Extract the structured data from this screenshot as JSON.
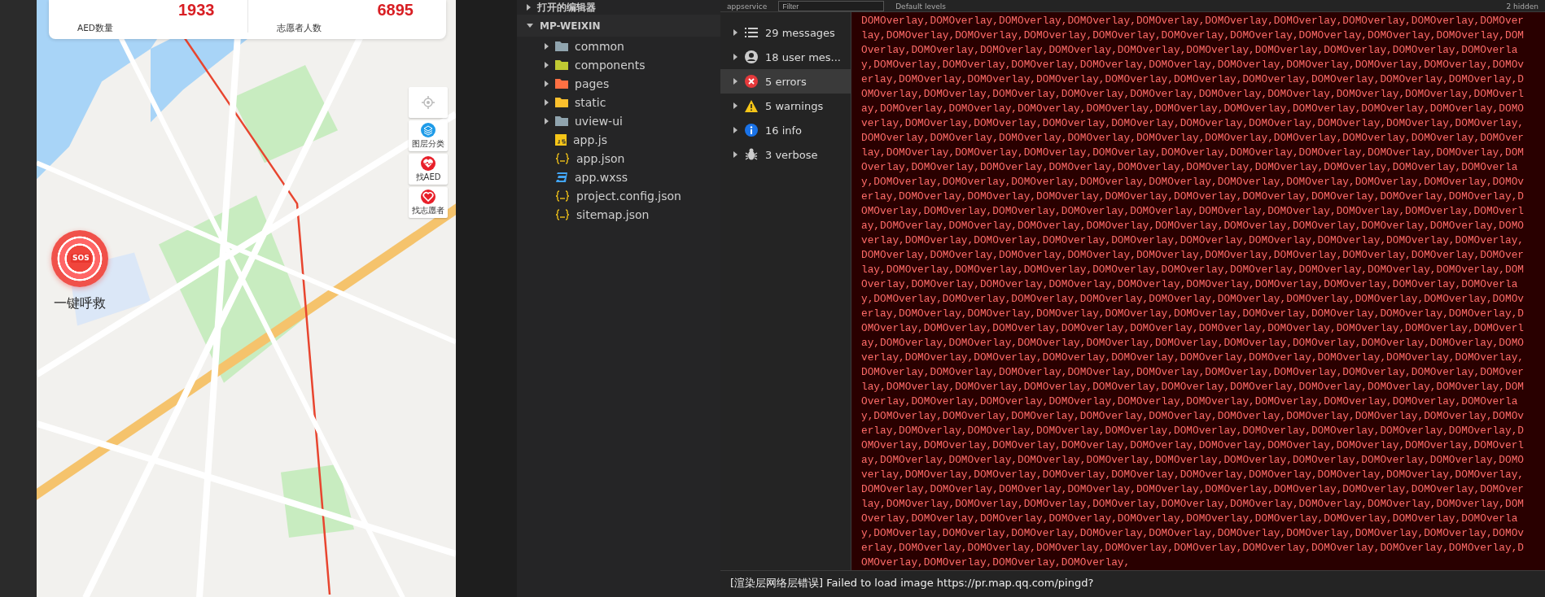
{
  "phone": {
    "stats": [
      {
        "value": "1933",
        "label": "AED数量"
      },
      {
        "value": "6895",
        "label": "志愿者人数"
      }
    ],
    "sos": {
      "badge": "SOS",
      "caption": "一键呼救"
    },
    "controls": [
      {
        "kind": "locate"
      },
      {
        "kind": "layers",
        "label": "图层分类"
      },
      {
        "kind": "aed",
        "label": "找AED"
      },
      {
        "kind": "volunteer",
        "label": "找志愿者"
      }
    ]
  },
  "explorer": {
    "sections": [
      {
        "title": "打开的编辑器",
        "expanded": false
      },
      {
        "title": "MP-WEIXIN",
        "expanded": true
      }
    ],
    "items": [
      {
        "kind": "folder",
        "name": "common",
        "color": "#90a4ae",
        "expanded": false
      },
      {
        "kind": "folder",
        "name": "components",
        "color": "#c0ca33",
        "expanded": false
      },
      {
        "kind": "folder",
        "name": "pages",
        "color": "#ff7043",
        "expanded": false
      },
      {
        "kind": "folder",
        "name": "static",
        "color": "#fbc02d",
        "expanded": false
      },
      {
        "kind": "folder",
        "name": "uview-ui",
        "color": "#90a4ae",
        "expanded": false
      },
      {
        "kind": "js",
        "name": "app.js"
      },
      {
        "kind": "json",
        "name": "app.json"
      },
      {
        "kind": "css",
        "name": "app.wxss"
      },
      {
        "kind": "json",
        "name": "project.config.json"
      },
      {
        "kind": "json",
        "name": "sitemap.json"
      }
    ]
  },
  "console": {
    "toolbar": {
      "context": "appservice",
      "filter_placeholder": "Filter",
      "levels": "Default levels",
      "hidden": "2 hidden"
    },
    "filters": [
      {
        "kind": "messages",
        "label": "29 messages",
        "selected": false
      },
      {
        "kind": "user",
        "label": "18 user mes...",
        "selected": false
      },
      {
        "kind": "errors",
        "label": "5 errors",
        "selected": true
      },
      {
        "kind": "warnings",
        "label": "5 warnings",
        "selected": false
      },
      {
        "kind": "info",
        "label": "16 info",
        "selected": false
      },
      {
        "kind": "verbose",
        "label": "3 verbose",
        "selected": false
      }
    ],
    "log": "DOMOverlay,DOMOverlay,DOMOverlay,DOMOverlay,DOMOverlay,DOMOverlay,DOMOverlay,DOMOverlay,DOMOverlay,DOMOverlay,DOMOverlay,DOMOverlay,DOMOverlay,DOMOverlay,DOMOverlay,DOMOverlay,DOMOverlay,DOMOverlay,DOMOverlay,DOMOverlay,DOMOverlay,DOMOverlay,DOMOverlay,DOMOverlay,DOMOverlay,DOMOverlay,DOMOverlay,DOMOverlay,DOMOverlay,DOMOverlay,DOMOverlay,DOMOverlay,DOMOverlay,DOMOverlay,DOMOverlay,DOMOverlay,DOMOverlay,DOMOverlay,DOMOverlay,DOMOverlay,DOMOverlay,DOMOverlay,DOMOverlay,DOMOverlay,DOMOverlay,DOMOverlay,DOMOverlay,DOMOverlay,DOMOverlay,DOMOverlay,DOMOverlay,DOMOverlay,DOMOverlay,DOMOverlay,DOMOverlay,DOMOverlay,DOMOverlay,DOMOverlay,DOMOverlay,DOMOverlay,DOMOverlay,DOMOverlay,DOMOverlay,DOMOverlay,DOMOverlay,DOMOverlay,DOMOverlay,DOMOverlay,DOMOverlay,DOMOverlay,DOMOverlay,DOMOverlay,DOMOverlay,DOMOverlay,DOMOverlay,DOMOverlay,DOMOverlay,DOMOverlay,DOMOverlay,DOMOverlay,DOMOverlay,DOMOverlay,DOMOverlay,DOMOverlay,DOMOverlay,DOMOverlay,DOMOverlay,DOMOverlay,DOMOverlay,DOMOverlay,DOMOverlay,DOMOverlay,DOMOverlay,DOMOverlay,DOMOverlay,DOMOverlay,DOMOverlay,DOMOverlay,DOMOverlay,DOMOverlay,DOMOverlay,DOMOverlay,DOMOverlay,DOMOverlay,DOMOverlay,DOMOverlay,DOMOverlay,DOMOverlay,DOMOverlay,DOMOverlay,DOMOverlay,DOMOverlay,DOMOverlay,DOMOverlay,DOMOverlay,DOMOverlay,DOMOverlay,DOMOverlay,DOMOverlay,DOMOverlay,DOMOverlay,DOMOverlay,DOMOverlay,DOMOverlay,DOMOverlay,DOMOverlay,DOMOverlay,DOMOverlay,DOMOverlay,DOMOverlay,DOMOverlay,DOMOverlay,DOMOverlay,DOMOverlay,DOMOverlay,DOMOverlay,DOMOverlay,DOMOverlay,DOMOverlay,DOMOverlay,DOMOverlay,DOMOverlay,DOMOverlay,DOMOverlay,DOMOverlay,DOMOverlay,DOMOverlay,DOMOverlay,DOMOverlay,DOMOverlay,DOMOverlay,DOMOverlay,DOMOverlay,DOMOverlay,DOMOverlay,DOMOverlay,DOMOverlay,DOMOverlay,DOMOverlay,DOMOverlay,DOMOverlay,DOMOverlay,DOMOverlay,DOMOverlay,DOMOverlay,DOMOverlay,DOMOverlay,DOMOverlay,DOMOverlay,DOMOverlay,DOMOverlay,DOMOverlay,DOMOverlay,DOMOverlay,DOMOverlay,DOMOverlay,DOMOverlay,DOMOverlay,DOMOverlay,DOMOverlay,DOMOverlay,DOMOverlay,DOMOverlay,DOMOverlay,DOMOverlay,DOMOverlay,DOMOverlay,DOMOverlay,DOMOverlay,DOMOverlay,DOMOverlay,DOMOverlay,DOMOverlay,DOMOverlay,DOMOverlay,DOMOverlay,DOMOverlay,DOMOverlay,DOMOverlay,DOMOverlay,DOMOverlay,DOMOverlay,DOMOverlay,DOMOverlay,DOMOverlay,DOMOverlay,DOMOverlay,DOMOverlay,DOMOverlay,DOMOverlay,DOMOverlay,DOMOverlay,DOMOverlay,DOMOverlay,DOMOverlay,DOMOverlay,DOMOverlay,DOMOverlay,DOMOverlay,DOMOverlay,DOMOverlay,DOMOverlay,DOMOverlay,DOMOverlay,DOMOverlay,DOMOverlay,DOMOverlay,DOMOverlay,DOMOverlay,DOMOverlay,DOMOverlay,DOMOverlay,DOMOverlay,DOMOverlay,DOMOverlay,DOMOverlay,DOMOverlay,DOMOverlay,DOMOverlay,DOMOverlay,DOMOverlay,DOMOverlay,DOMOverlay,DOMOverlay,DOMOverlay,DOMOverlay,DOMOverlay,DOMOverlay,DOMOverlay,DOMOverlay,DOMOverlay,DOMOverlay,DOMOverlay,DOMOverlay,DOMOverlay,DOMOverlay,DOMOverlay,DOMOverlay,DOMOverlay,DOMOverlay,DOMOverlay,DOMOverlay,DOMOverlay,DOMOverlay,DOMOverlay,DOMOverlay,DOMOverlay,DOMOverlay,DOMOverlay,DOMOverlay,DOMOverlay,DOMOverlay,DOMOverlay,DOMOverlay,DOMOverlay,DOMOverlay,DOMOverlay,DOMOverlay,DOMOverlay,DOMOverlay,DOMOverlay,DOMOverlay,DOMOverlay,DOMOverlay,DOMOverlay,DOMOverlay,DOMOverlay,DOMOverlay,DOMOverlay,DOMOverlay,DOMOverlay,DOMOverlay,DOMOverlay,DOMOverlay,DOMOverlay,DOMOverlay,DOMOverlay,DOMOverlay,DOMOverlay,DOMOverlay,DOMOverlay,DOMOverlay,DOMOverlay,DOMOverlay,DOMOverlay,DOMOverlay,DOMOverlay,DOMOverlay,DOMOverlay,DOMOverlay,DOMOverlay,DOMOverlay,DOMOverlay,DOMOverlay,DOMOverlay,DOMOverlay,DOMOverlay,DOMOverlay,DOMOverlay,DOMOverlay,DOMOverlay,DOMOverlay,DOMOverlay,DOMOverlay,DOMOverlay,DOMOverlay,DOMOverlay,DOMOverlay,DOMOverlay,DOMOverlay,DOMOverlay,DOMOverlay,DOMOverlay,DOMOverlay,DOMOverlay,DOMOverlay,DOMOverlay,DOMOverlay,DOMOverlay,DOMOverlay,DOMOverlay,DOMOverlay,DOMOverlay,DOMOverlay,DOMOverlay,DOMOverlay,DOMOverlay,DOMOverlay,DOMOverlay,DOMOverlay,DOMOverlay,DOMOverlay,DOMOverlay,DOMOverlay,DOMOverlay,DOMOverlay,DOMOverlay,DOMOverlay,DOMOverlay,DOMOverlay,",
    "status": "[渲染层网络层错误] Failed to load image https://pr.map.qq.com/pingd?"
  }
}
